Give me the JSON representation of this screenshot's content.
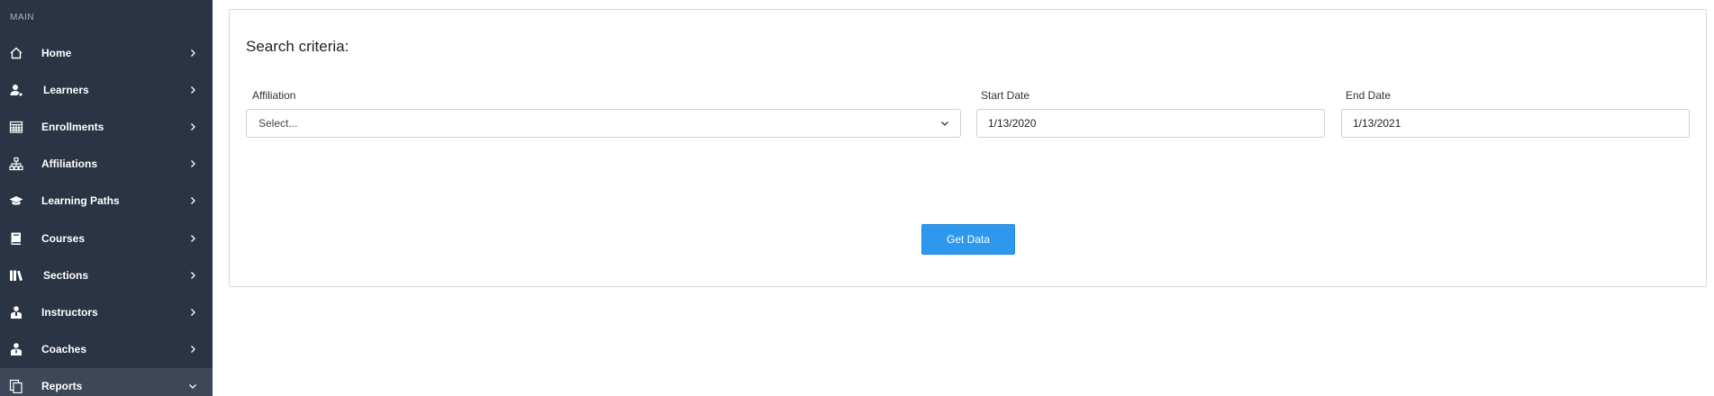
{
  "sidebar": {
    "section_label": "MAIN",
    "items": [
      {
        "label": "Home",
        "icon": "home-icon"
      },
      {
        "label": "Learners",
        "icon": "user-icon"
      },
      {
        "label": "Enrollments",
        "icon": "calendar-icon"
      },
      {
        "label": "Affiliations",
        "icon": "sitemap-icon"
      },
      {
        "label": "Learning Paths",
        "icon": "graduation-cap-icon"
      },
      {
        "label": "Courses",
        "icon": "book-icon"
      },
      {
        "label": "Sections",
        "icon": "books-icon"
      },
      {
        "label": "Instructors",
        "icon": "instructor-icon"
      },
      {
        "label": "Coaches",
        "icon": "coach-icon"
      },
      {
        "label": "Reports",
        "icon": "reports-icon",
        "expanded": true
      }
    ]
  },
  "search": {
    "title": "Search criteria:",
    "affiliation_label": "Affiliation",
    "affiliation_value": "Select...",
    "start_date_label": "Start Date",
    "start_date_value": "1/13/2020",
    "end_date_label": "End Date",
    "end_date_value": "1/13/2021",
    "button_label": "Get Data"
  },
  "colors": {
    "sidebar_bg": "#2b3445",
    "sidebar_active_bg": "#3d4757",
    "button_bg": "#2d98ee"
  }
}
